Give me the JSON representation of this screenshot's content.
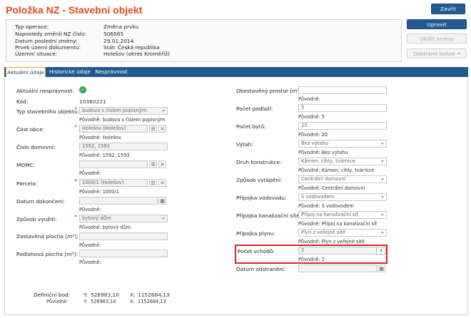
{
  "page": {
    "title": "Položka NZ - Stavební objekt"
  },
  "actions": {
    "close": "Zavřít",
    "edit": "Upravit",
    "save": "Uložit změny",
    "remove_collision": "Odstranit kolize"
  },
  "info": {
    "rows": [
      {
        "label": "Typ operace:",
        "value": "Změna prvku"
      },
      {
        "label": "Naposledy změnil NZ číslo:",
        "value": "506565"
      },
      {
        "label": "Datum poslední změny:",
        "value": "29.01.2014"
      },
      {
        "label": "Prvek území dokumentu:",
        "value": "Stát: Česká republika"
      },
      {
        "label": "Územní situace:",
        "value": "Holešov (okres Kroměříž)"
      }
    ]
  },
  "tabs": [
    "Aktuální údaje",
    "Historické údaje",
    "Nesprávnost"
  ],
  "left": {
    "nespravnost_label": "Aktuální nesprávnost:",
    "kod_label": "Kód:",
    "kod_value": "10360221",
    "typ_label": "Typ stavebního objektu:",
    "typ_value": "budova s číslem popisným",
    "typ_orig": "Původně: budova s číslem popisným",
    "cast_label": "Část obce:",
    "cast_value": "Holešov (Holešov)",
    "cast_orig": "Původně: Holešov",
    "cislo_label": "Číslo domovní:",
    "cislo_value": "1592, 1593",
    "cislo_orig": "Původně: 1592, 1593",
    "momc_label": "MOMC:",
    "momc_orig": "Původně:",
    "parcela_label": "Parcela:",
    "parcela_value": "1000/1 (Holešov)",
    "parcela_orig": "Původně: 1000/1",
    "dokonceni_label": "Datum dokončení:",
    "dokonceni_orig": "Původně:",
    "vyuziti_label": "Způsob využití:",
    "vyuziti_value": "bytový dům",
    "vyuziti_orig": "Původně: bytový dům",
    "zastavena_label": "Zastavěná plocha [m²]:",
    "zastavena_orig": "Původně:",
    "podlahova_label": "Podlahová plocha [m²]:",
    "podlahova_orig": "Původně:",
    "def_label": "Definiční bod:",
    "def_orig_label": "Původně:",
    "y_label": "Y:",
    "x_label": "X:",
    "def_y": "526983,10",
    "def_x": "1152684,13",
    "orig_y": "526983,10",
    "orig_x": "1152684,13"
  },
  "right": {
    "obestaveny_label": "Obestavěný prostor [m³]:",
    "obestaveny_orig": "Původně:",
    "podlazi_label": "Počet podlaží:",
    "podlazi_value": "5",
    "podlazi_orig": "Původně: 5",
    "byty_label": "Počet bytů:",
    "byty_value": "20",
    "byty_orig": "Původně: 20",
    "vytah_label": "Výtah:",
    "vytah_value": "Bez výtahu",
    "vytah_orig": "Původně: Bez výtahu",
    "konstrukce_label": "Druh konstrukce:",
    "konstrukce_value": "Kámen, cihly, tvárnice",
    "konstrukce_orig": "Původně: Kámen, cihly, tvárnice",
    "vytapeni_label": "Způsob vytápění:",
    "vytapeni_value": "Centrální domovní",
    "vytapeni_orig": "Původně: Centrální domovní",
    "vodovod_label": "Přípojka vodovodu:",
    "vodovod_value": "S vodovodem",
    "vodovod_orig": "Původně: S vodovodem",
    "kanalizace_label": "Přípojka kanalizační sítě:",
    "kanalizace_value": "Přípoj na kanalizační síť",
    "kanalizace_orig": "Původně: Přípoj na kanalizační síť",
    "plyn_label": "Přípojka plynu:",
    "plyn_value": "Plyn z veřejné sítě",
    "plyn_orig": "Původně: Plyn z veřejné sítě",
    "vchody_label": "Počet vchodů:",
    "vchody_value": "2",
    "vchody_orig": "Původně: 2",
    "odstraneni_label": "Datum odstranění:"
  },
  "colors": {
    "title": "#e04b1b",
    "primary": "#235a92",
    "highlight": "#d7262e",
    "ok": "#32a852"
  }
}
